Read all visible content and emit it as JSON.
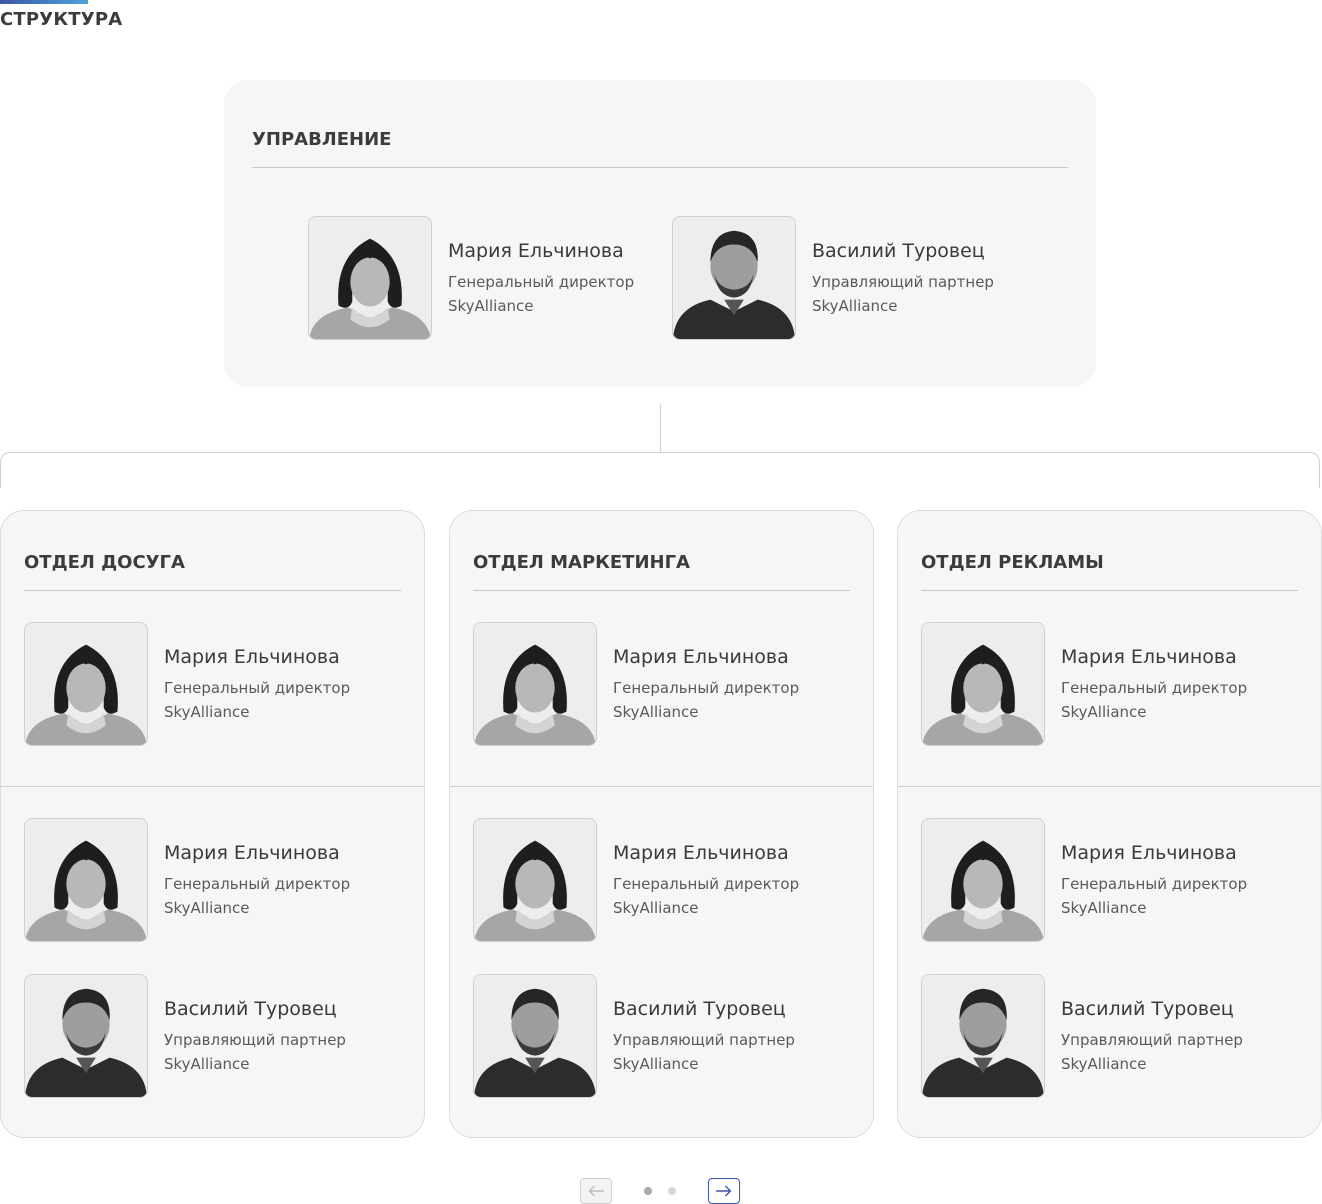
{
  "section": {
    "title": "СТРУКТУРА"
  },
  "management": {
    "title": "УПРАВЛЕНИЕ",
    "people": [
      {
        "name": "Мария Ельчинова",
        "role": "Генеральный директор",
        "org": "SkyAlliance",
        "photo": "woman-portrait"
      },
      {
        "name": "Василий Туровец",
        "role": "Управляющий партнер",
        "org": "SkyAlliance",
        "photo": "man-portrait"
      }
    ]
  },
  "departments": [
    {
      "title": "ОТДЕЛ ДОСУГА",
      "head": {
        "name": "Мария Ельчинова",
        "role": "Генеральный директор",
        "org": "SkyAlliance",
        "photo": "woman-portrait"
      },
      "members": [
        {
          "name": "Мария Ельчинова",
          "role": "Генеральный директор",
          "org": "SkyAlliance",
          "photo": "woman-portrait"
        },
        {
          "name": "Василий Туровец",
          "role": "Управляющий партнер",
          "org": "SkyAlliance",
          "photo": "man-portrait"
        }
      ]
    },
    {
      "title": "ОТДЕЛ МАРКЕТИНГА",
      "head": {
        "name": "Мария Ельчинова",
        "role": "Генеральный директор",
        "org": "SkyAlliance",
        "photo": "woman-portrait"
      },
      "members": [
        {
          "name": "Мария Ельчинова",
          "role": "Генеральный директор",
          "org": "SkyAlliance",
          "photo": "woman-portrait"
        },
        {
          "name": "Василий Туровец",
          "role": "Управляющий партнер",
          "org": "SkyAlliance",
          "photo": "man-portrait"
        }
      ]
    },
    {
      "title": "ОТДЕЛ РЕКЛАМЫ",
      "head": {
        "name": "Мария Ельчинова",
        "role": "Генеральный директор",
        "org": "SkyAlliance",
        "photo": "woman-portrait"
      },
      "members": [
        {
          "name": "Мария Ельчинова",
          "role": "Генеральный директор",
          "org": "SkyAlliance",
          "photo": "woman-portrait"
        },
        {
          "name": "Василий Туровец",
          "role": "Управляющий партнер",
          "org": "SkyAlliance",
          "photo": "man-portrait"
        }
      ]
    }
  ],
  "pager": {
    "prev_icon": "arrow-left-icon",
    "next_icon": "arrow-right-icon",
    "page_count": 2,
    "active_page": 1
  },
  "colors": {
    "accent": "#3c55a5",
    "accent_light": "#4fa3d9",
    "card_bg": "#f6f6f6",
    "text": "#3c3c3c"
  }
}
